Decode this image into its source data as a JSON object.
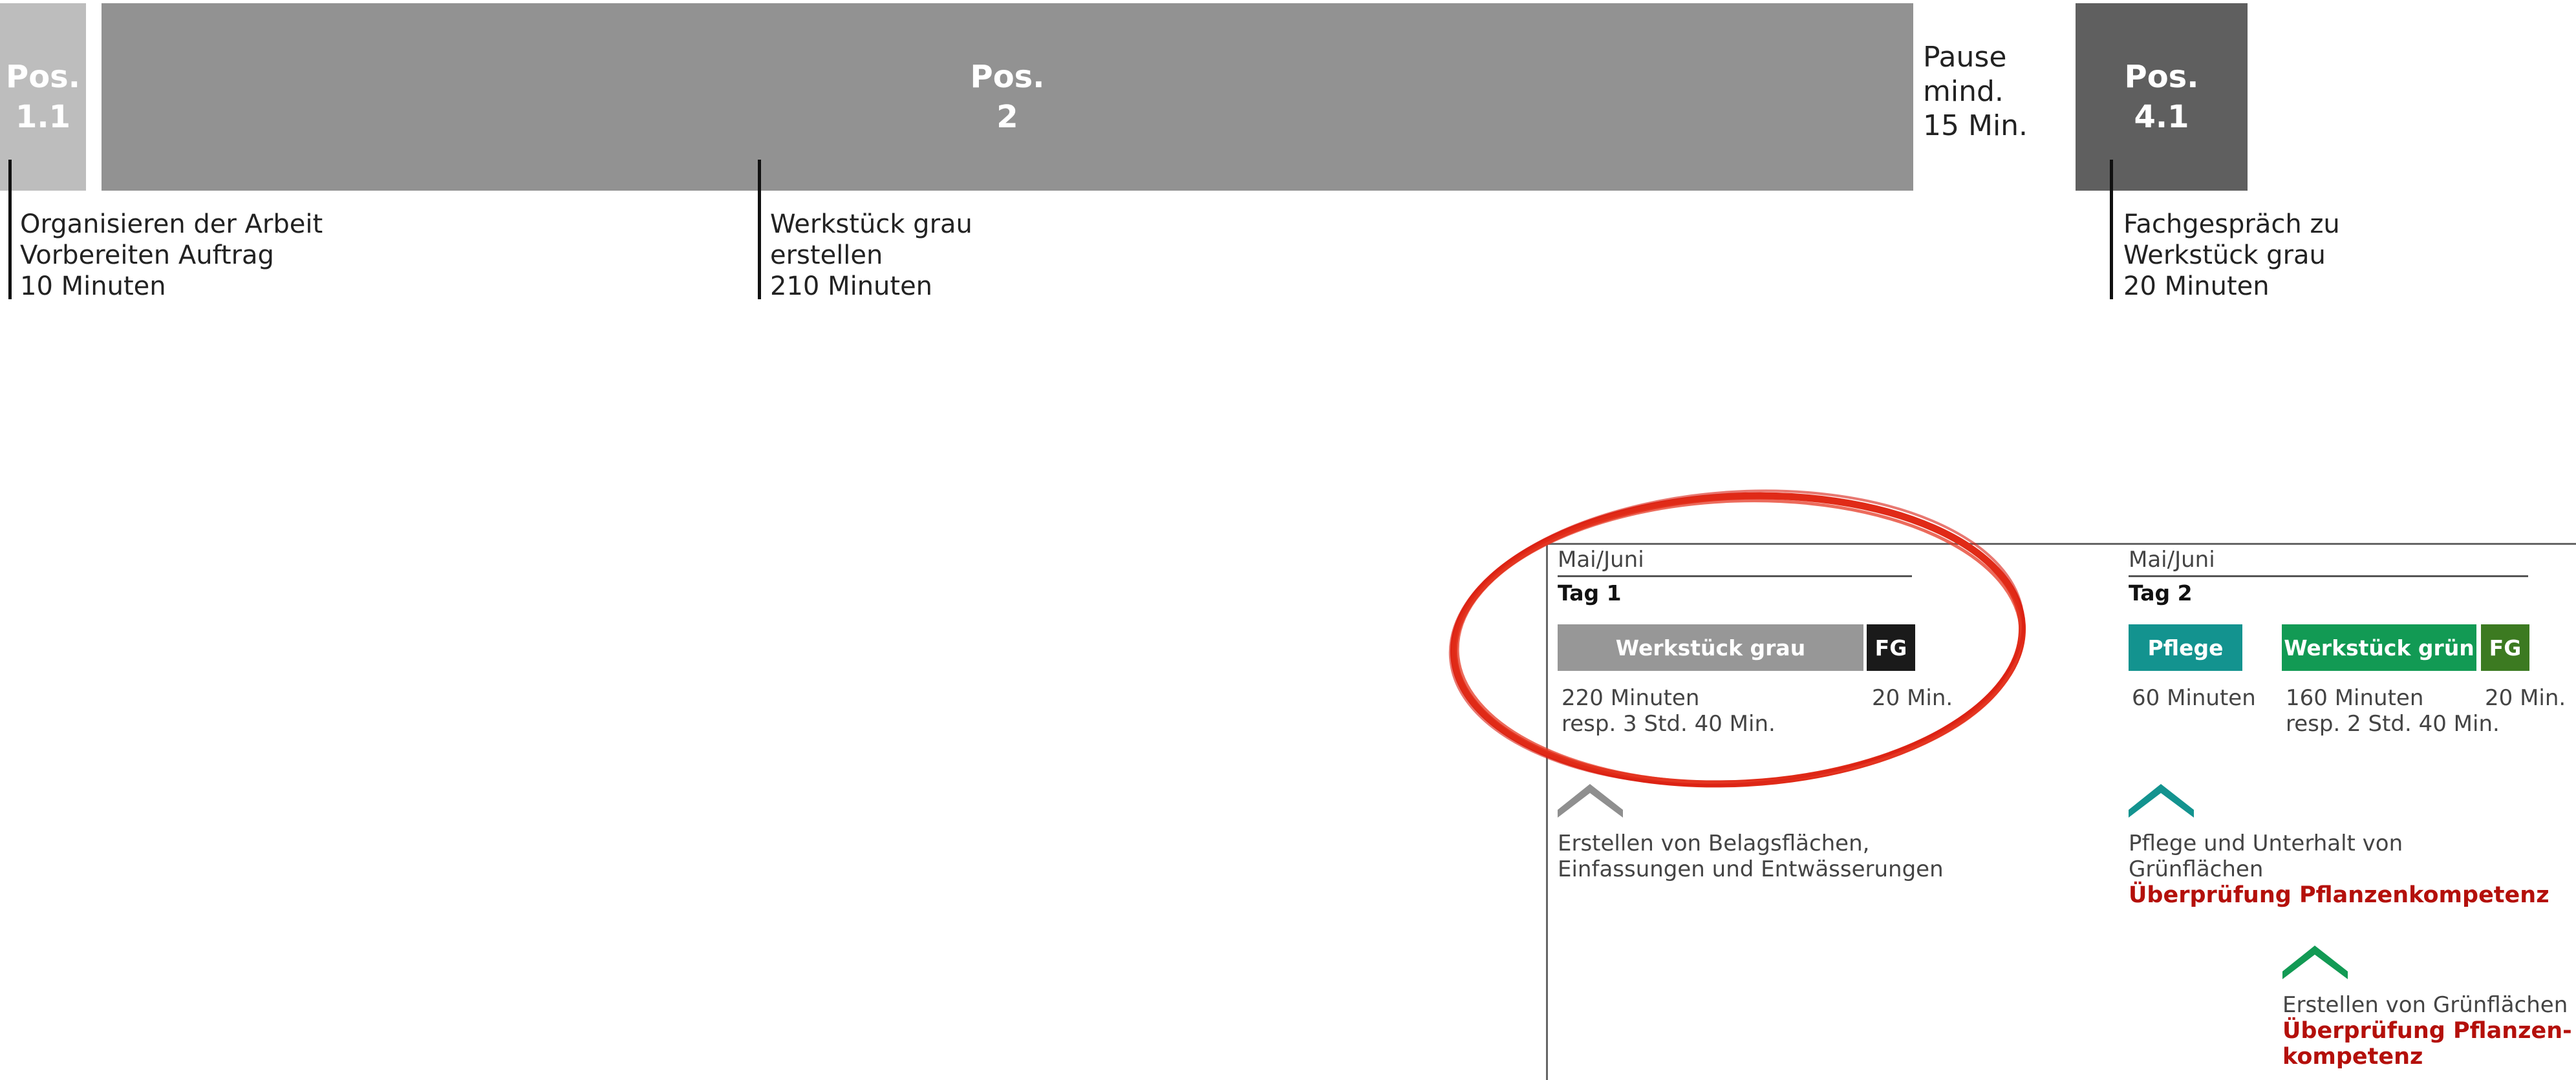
{
  "timeline": {
    "pos11": {
      "line1": "Pos.",
      "line2": "1.1"
    },
    "pos2": {
      "line1": "Pos.",
      "line2": "2"
    },
    "pos41": {
      "line1": "Pos.",
      "line2": "4.1"
    },
    "pause": {
      "line1": "Pause",
      "line2": "mind.",
      "line3": "15 Min."
    },
    "desc11": {
      "line1": "Organisieren der Arbeit",
      "line2": "Vorbereiten Auftrag",
      "line3": "10 Minuten"
    },
    "desc2": {
      "line1": "Werkstück grau",
      "line2": "erstellen",
      "line3": "210 Minuten"
    },
    "desc41": {
      "line1": "Fachgespräch zu",
      "line2": "Werkstück grau",
      "line3": "20 Minuten"
    },
    "colors": {
      "pos11": "#bdbdbd",
      "pos2": "#929292",
      "pos41": "#5f5f5f"
    }
  },
  "day1": {
    "period": "Mai/Juni",
    "title": "Tag 1",
    "bar_main": "Werkstück grau",
    "bar_fg": "FG",
    "time_main_1": "220 Minuten",
    "time_main_2": "resp. 3 Std. 40 Min.",
    "time_fg": "20 Min.",
    "topic_1": "Erstellen von Belagsflächen,",
    "topic_2": "Einfassungen und Entwässerungen",
    "chevron_icon": "chevron-up-icon-grey",
    "highlight": "red-hand-drawn-ellipse"
  },
  "day2": {
    "period": "Mai/Juni",
    "title": "Tag 2",
    "bar_pflege": "Pflege",
    "bar_gruen": "Werkstück grün",
    "bar_fg": "FG",
    "time_pflege": "60 Minuten",
    "time_gruen_1": "160 Minuten",
    "time_gruen_2": "resp. 2 Std. 40 Min.",
    "time_fg": "20 Min.",
    "topic_pflege_1": "Pflege und Unterhalt von",
    "topic_pflege_2": "Grünflächen",
    "check_pflege": "Überprüfung Pflanzenkompetenz",
    "topic_gruen": "Erstellen von Grünflächen",
    "check_gruen_1": "Überprüfung Pflanzen-",
    "check_gruen_2": "kompetenz",
    "chevron_teal_icon": "chevron-up-icon-teal",
    "chevron_green_icon": "chevron-up-icon-green"
  }
}
